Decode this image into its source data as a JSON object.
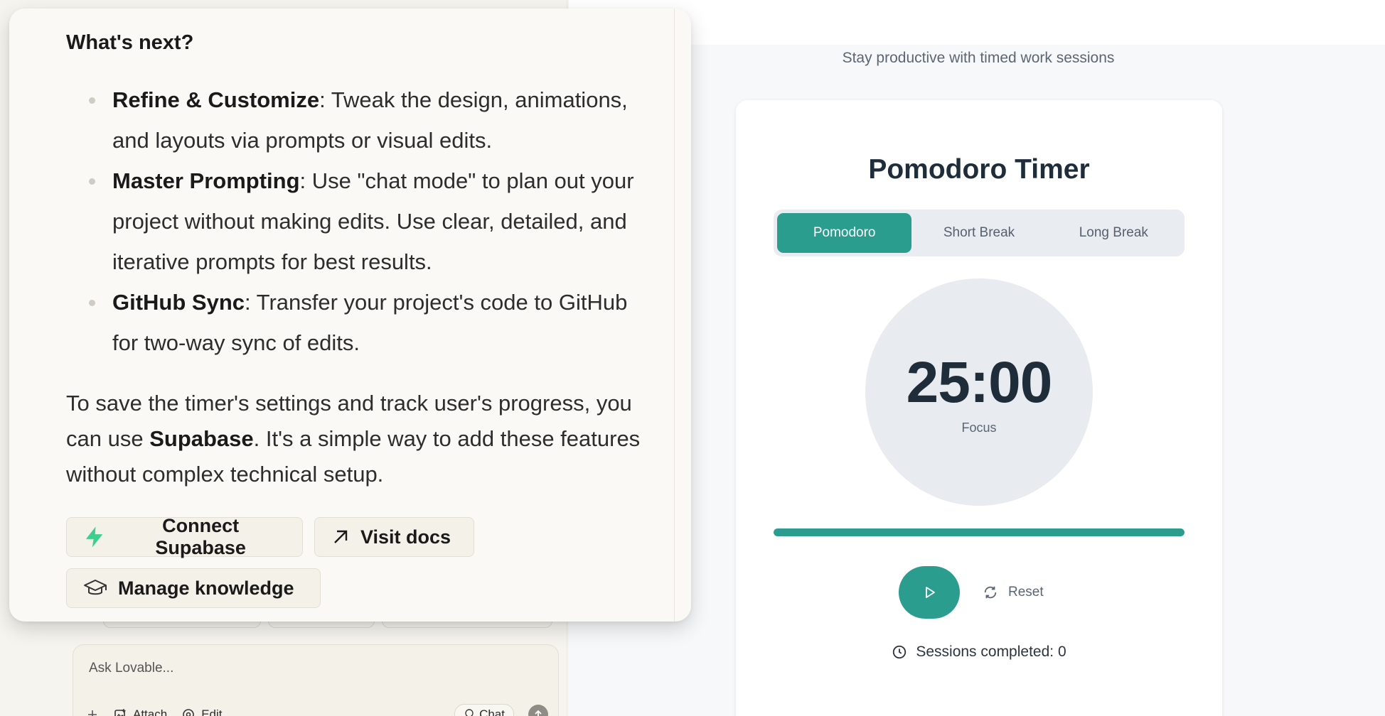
{
  "preview": {
    "subtitle": "Stay productive with timed work sessions",
    "title": "Pomodoro Timer",
    "tabs": [
      {
        "label": "Pomodoro",
        "active": true
      },
      {
        "label": "Short Break",
        "active": false
      },
      {
        "label": "Long Break",
        "active": false
      }
    ],
    "time": "25:00",
    "mode_label": "Focus",
    "progress_percent": 100,
    "reset_label": "Reset",
    "sessions_text": "Sessions completed: 0",
    "accent_color": "#2a9d8f",
    "icons": {
      "play": "play-icon",
      "reset": "refresh-icon",
      "sessions": "clock-icon"
    }
  },
  "message": {
    "heading": "What's next?",
    "items": [
      {
        "title": "Refine & Customize",
        "text": ": Tweak the design, animations, and layouts via prompts or visual edits."
      },
      {
        "title": "Master Prompting",
        "text": ": Use \"chat mode\" to plan out your project without making edits. Use clear, detailed, and iterative prompts for best results."
      },
      {
        "title": "GitHub Sync",
        "text": ": Transfer your project's code to GitHub for two-way sync of edits."
      }
    ],
    "paragraph_before": "To save the timer's settings and track user's progress, you can use ",
    "paragraph_bold": "Supabase",
    "paragraph_after": ". It's a simple way to add these features without complex technical setup.",
    "actions": {
      "connect": "Connect Supabase",
      "docs": "Visit docs",
      "knowledge": "Manage knowledge"
    },
    "icons": {
      "connect": "supabase-bolt-icon",
      "docs": "arrow-up-right-icon",
      "knowledge": "graduation-cap-icon"
    },
    "supabase_color": "#3ecf8e"
  },
  "composer": {
    "placeholder": "Ask Lovable...",
    "attach_label": "Attach",
    "edit_label": "Edit",
    "chat_label": "Chat",
    "icons": {
      "add": "plus-icon",
      "attach": "image-attach-icon",
      "edit": "target-edit-icon",
      "chat": "lightbulb-icon",
      "send": "arrow-up-icon"
    }
  }
}
